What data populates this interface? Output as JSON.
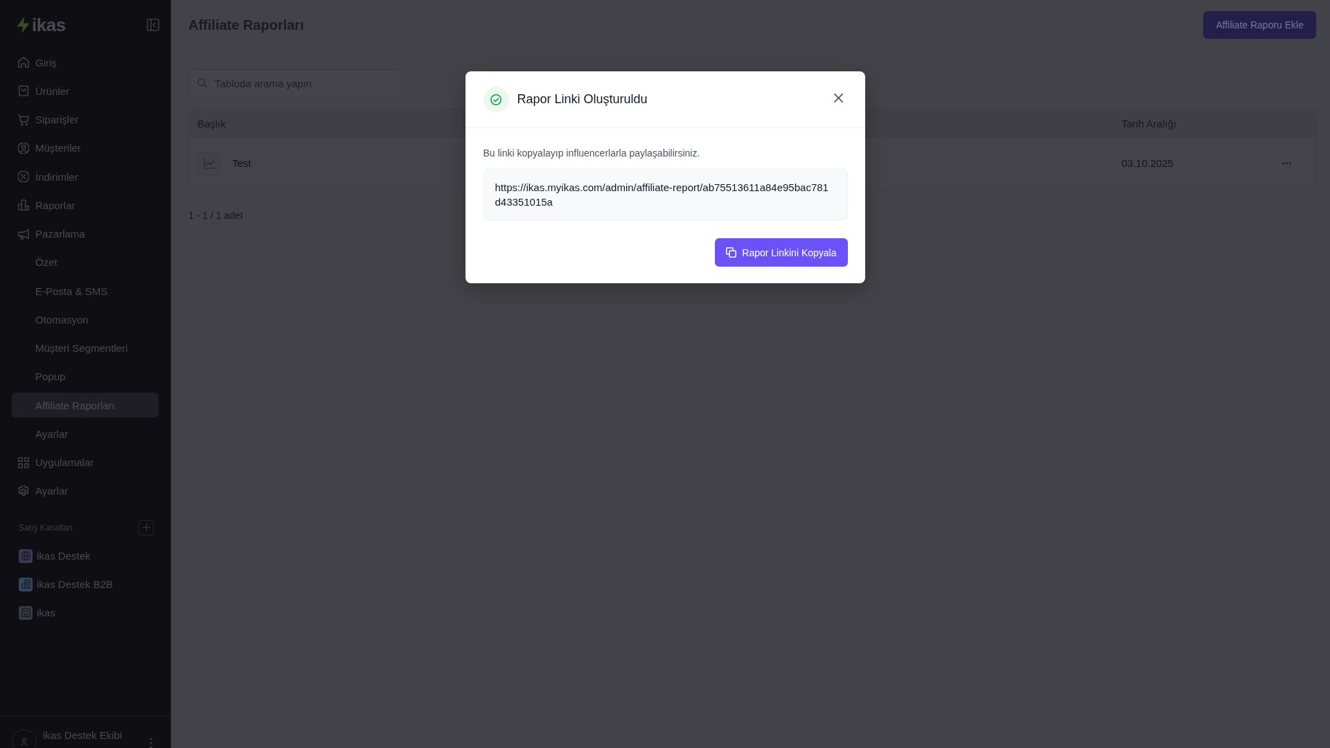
{
  "sidebar": {
    "logo": "ikas",
    "items": [
      {
        "label": "Giriş",
        "selected": false
      },
      {
        "label": "Ürünler",
        "selected": false
      },
      {
        "label": "Siparişler",
        "selected": false
      },
      {
        "label": "Müşteriler",
        "selected": false
      },
      {
        "label": "İndirimler",
        "selected": false
      },
      {
        "label": "Raporlar",
        "selected": false
      },
      {
        "label": "Pazarlama",
        "selected": false,
        "children": [
          {
            "label": "Özet",
            "selected": false
          },
          {
            "label": "E-Posta & SMS",
            "selected": false
          },
          {
            "label": "Otomasyon",
            "selected": false
          },
          {
            "label": "Müşteri Segmentleri",
            "selected": false
          },
          {
            "label": "Popup",
            "selected": false
          },
          {
            "label": "Affiliate Raporları",
            "selected": true
          },
          {
            "label": "Ayarlar",
            "selected": false
          }
        ]
      },
      {
        "label": "Uygulamalar",
        "selected": false
      },
      {
        "label": "Ayarlar",
        "selected": false
      }
    ],
    "channels_heading": "Satış Kanalları",
    "channels": [
      {
        "label": "ikas Destek",
        "color": "#3b3757"
      },
      {
        "label": "ikas Destek B2B",
        "color": "#33465b"
      },
      {
        "label": "ikas",
        "color": "#353943"
      }
    ],
    "user": {
      "name": "ikas Destek Ekibi"
    }
  },
  "page": {
    "title": "Affiliate Raporları",
    "add_button": "Affiliate Raporu Ekle"
  },
  "search": {
    "placeholder": "Tabloda arama yapın"
  },
  "table": {
    "columns": [
      "Başlık",
      "Tarih Aralığı"
    ],
    "rows": [
      {
        "title": "Test",
        "date_range": "03.10.2025"
      }
    ]
  },
  "pagination": "1 - 1 / 1 adet",
  "dialog": {
    "title": "Rapor Linki Oluşturuldu",
    "message": "Bu linki kopyalayıp influencerlarla paylaşabilirsiniz.",
    "link": "https://ikas.myikas.com/admin/affiliate-report/ab75513611a84e95bac781d43351015a",
    "copy_button": "Rapor Linkini Kopyala"
  }
}
